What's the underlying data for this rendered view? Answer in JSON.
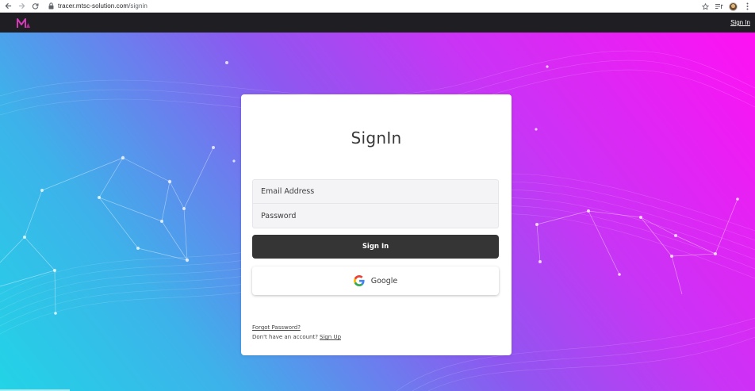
{
  "browser": {
    "url_host": "tracer.mtsc-solution.com",
    "url_path": "/signin",
    "icons": [
      "back-arrow-icon",
      "forward-arrow-icon",
      "reload-icon",
      "lock-icon",
      "star-icon",
      "playlist-icon",
      "profile-avatar",
      "kebab-menu-icon"
    ]
  },
  "header": {
    "signin_link": "Sign In",
    "logo_icon": "mtsc-logo-icon"
  },
  "card": {
    "title": "SignIn",
    "email_placeholder": "Email Address",
    "password_placeholder": "Password",
    "signin_button": "Sign In",
    "google_button": "Google",
    "forgot_password": "Forgot Password?",
    "no_account_text": "Don't have an account?",
    "signup_link": "Sign Up"
  },
  "colors": {
    "header_bg": "#1f1f23",
    "gradient_start": "#22d4e6",
    "gradient_mid": "#8d58f0",
    "gradient_end": "#ff11f3",
    "signin_button_bg": "#353535",
    "field_bg": "#f4f4f6"
  }
}
